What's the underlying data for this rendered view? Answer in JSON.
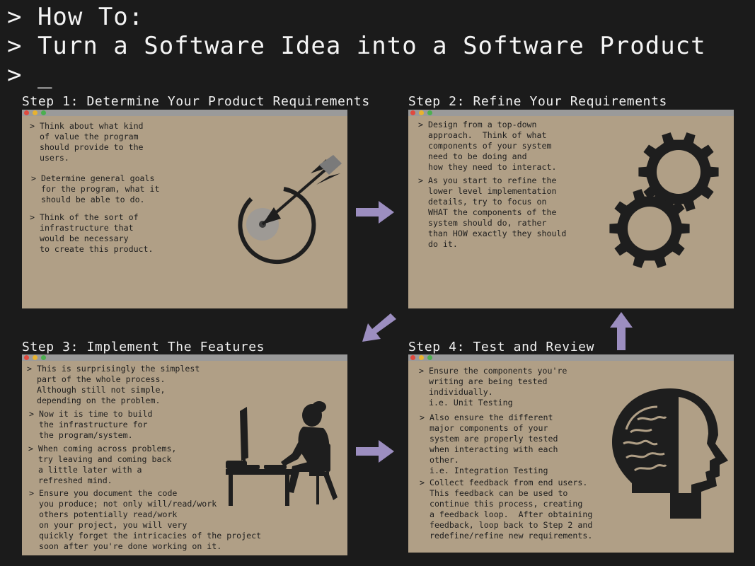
{
  "header": {
    "line1": "> How To:",
    "line2": "> Turn a Software Idea into a Software Product",
    "line3": "> _"
  },
  "steps": [
    {
      "title": "Step 1: Determine Your Product Requirements",
      "bullets": [
        "> Think about what kind\n  of value the program\n  should provide to the\n  users.",
        "> Determine general goals\n  for the program, what it\n  should be able to do.",
        "> Think of the sort of\n  infrastructure that\n  would be necessary\n  to create this product."
      ],
      "graphic": "target-arrow-icon"
    },
    {
      "title": "Step 2: Refine Your Requirements",
      "bullets": [
        "> Design from a top-down\n  approach.  Think of what\n  components of your system\n  need to be doing and\n  how they need to interact.",
        "> As you start to refine the\n  lower level implementation\n  details, try to focus on\n  WHAT the components of the\n  system should do, rather\n  than HOW exactly they should\n  do it."
      ],
      "graphic": "gears-icon"
    },
    {
      "title": "Step 3: Implement The Features",
      "bullets": [
        "> This is surprisingly the simplest\n  part of the whole process.\n  Although still not simple,\n  depending on the problem.",
        "> Now it is time to build\n  the infrastructure for\n  the program/system.",
        "> When coming across problems,\n  try leaving and coming back\n  a little later with a\n  refreshed mind.",
        "> Ensure you document the code\n  you produce; not only will/read/work\n  others potentially read/work\n  on your project, you will very\n  quickly forget the intricacies of the project\n  soon after you're done working on it."
      ],
      "graphic": "person-at-computer-icon"
    },
    {
      "title": "Step 4: Test and Review",
      "bullets": [
        "> Ensure the components you're\n  writing are being tested\n  individually.\n  i.e. Unit Testing",
        "> Also ensure the different\n  major components of your\n  system are properly tested\n  when interacting with each\n  other.\n  i.e. Integration Testing",
        "> Collect feedback from end users.\n  This feedback can be used to\n  continue this process, creating\n  a feedback loop.  After obtaining\n  feedback, loop back to Step 2 and\n  redefine/refine new requirements."
      ],
      "graphic": "head-lightbulb-icon"
    }
  ],
  "colors": {
    "background": "#1b1b1b",
    "panel": "#b09f86",
    "titlebar": "#9a9a9a",
    "arrow": "#9c8ec0",
    "ink": "#1e1e1e"
  }
}
